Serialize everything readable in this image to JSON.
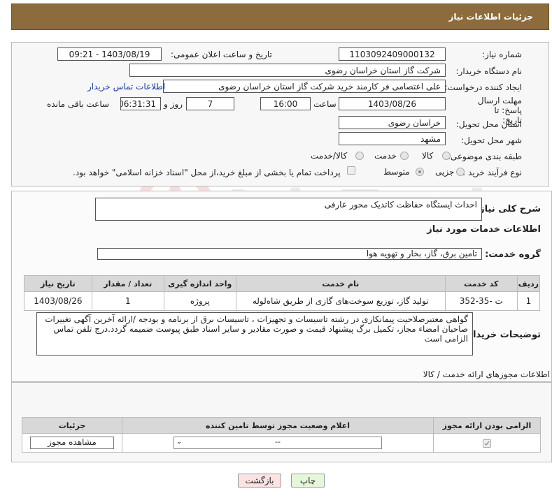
{
  "header": {
    "title": "جزئیات اطلاعات نیاز"
  },
  "fields": {
    "need_number_label": "شماره نیاز:",
    "need_number": "1103092409000132",
    "announce_label": "تاریخ و ساعت اعلان عمومی:",
    "announce_value": "1403/08/19 - 09:21",
    "buyer_org_label": "نام دستگاه خریدار:",
    "buyer_org": "شرکت گاز استان خراسان رضوی",
    "creator_label": "ایجاد کننده درخواست:",
    "creator": "علی اعتصامی فر کارمند خرید شرکت گاز استان خراسان رضوی",
    "buyer_contact_link": "اطلاعات تماس خریدار",
    "deadline_label": "مهلت ارسال پاسخ: تا تاریخ:",
    "deadline_date": "1403/08/26",
    "time_label": "ساعت",
    "deadline_time": "16:00",
    "days": "7",
    "days_label": "روز و",
    "remaining_time": "06:31:31",
    "remaining_label": "ساعت باقی مانده",
    "province_label": "استان محل تحویل:",
    "province": "خراسان رضوی",
    "city_label": "شهر محل تحویل:",
    "city": "مشهد",
    "category_label": "طبقه بندی موضوعی:",
    "category_options": [
      "کالا",
      "خدمت",
      "کالا/خدمت"
    ],
    "process_label": "نوع فرآیند خرید :",
    "process_options": [
      "جزیی",
      "متوسط"
    ],
    "payment_note": "پرداخت تمام یا بخشی از مبلغ خرید،از محل \"اسناد خزانه اسلامی\" خواهد بود."
  },
  "summary": {
    "label": "شرح کلی نیاز:",
    "value": "احداث ایستگاه حفاظت کاتدیک محور عارفی",
    "services_title": "اطلاعات خدمات مورد نیاز",
    "service_group_label": "گروه خدمت:",
    "service_group": "تامین برق، گاز، بخار و تهویه هوا"
  },
  "services_table": {
    "headers": [
      "ردیف",
      "کد خدمت",
      "نام خدمت",
      "واحد اندازه گیری",
      "تعداد / مقدار",
      "تاریخ نیاز"
    ],
    "rows": [
      [
        "1",
        "ت -35-352",
        "تولید گاز، توزیع سوخت‌های گازی از طریق شاه‌لوله",
        "پروژه",
        "1",
        "1403/08/26"
      ]
    ]
  },
  "buyer_notes": {
    "label": "توضیحات خریدار:",
    "text": "گواهی معتبرصلاحیت پیمانکاری در رشته تاسیسات و تجهیزات ، تاسیسات برق از برنامه و بودجه /ارائه آخرین آگهی تغییرات صاحبان امضاء مجاز، تکمیل برگ پیشنهاد قیمت و صورت مقادیر و سایر اسناد طبق پیوست ضمیمه گردد.درج تلفن تماس الزامی  است"
  },
  "permits": {
    "title": "اطلاعات مجوزهای ارائه خدمت / کالا",
    "headers": [
      "الزامی بودن ارائه مجوز",
      "اعلام وضعیت مجوز توسط تامین کننده",
      "جزئیات"
    ],
    "select_value": "--",
    "view_button": "مشاهده مجوز"
  },
  "buttons": {
    "print": "چاپ",
    "back": "بازگشت"
  },
  "watermark": "AriaTender.neT",
  "colors": {
    "header_bg": "#8c6b3c",
    "link": "#1a3ea8",
    "back_btn_bg": "#fce3e3",
    "print_btn_bg": "#e6f7d9"
  }
}
